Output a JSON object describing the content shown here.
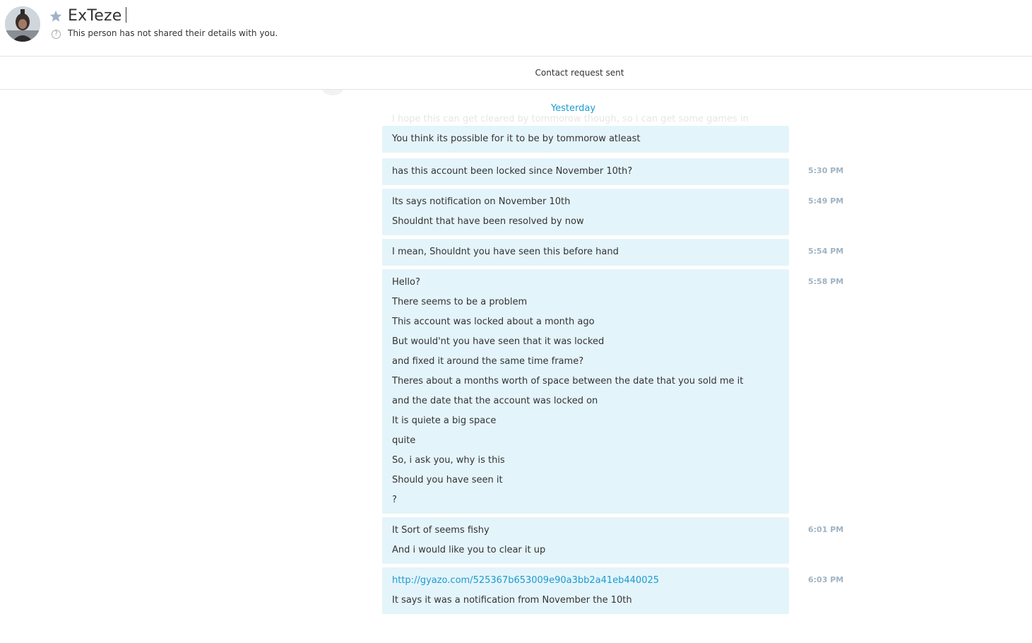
{
  "header": {
    "name": "ExTeze",
    "subtitle": "This person has not shared their details with you."
  },
  "request_bar": {
    "text": "Contact request sent"
  },
  "chat": {
    "day_label": "Yesterday",
    "faded_line": "I hope this can get cleared by tommorow though, so i can get some games in",
    "messages": [
      {
        "time": "",
        "lines": [
          "You think its possible for it to be by tommorow atleast"
        ]
      },
      {
        "time": "5:30 PM",
        "lines": [
          "has this account been locked since November 10th?"
        ]
      },
      {
        "time": "5:49 PM",
        "lines": [
          "Its says notification on November 10th",
          "Shouldnt that have been resolved by now"
        ]
      },
      {
        "time": "5:54 PM",
        "lines": [
          "I mean, Shouldnt you have seen this before hand"
        ]
      },
      {
        "time": "5:58 PM",
        "lines": [
          "Hello?",
          "There seems to be a problem",
          "This account was locked about a month ago",
          "But would'nt you have seen that it was locked",
          "and fixed it around the same time frame?",
          "Theres about a months worth of space between the date that you sold me it",
          "and the date that the account was locked on",
          "It is quiete a big space",
          "quite",
          "So, i ask you, why is this",
          "Should you have seen it",
          "?"
        ]
      },
      {
        "time": "6:01 PM",
        "lines": [
          "It Sort of seems fishy",
          "And i would like you to clear it up"
        ]
      },
      {
        "time": "6:03 PM",
        "link": "http://gyazo.com/525367b653009e90a3bb2a41eb440025",
        "lines": [
          "It says it was a notification from November the 10th"
        ]
      }
    ]
  },
  "colors": {
    "bubble": "#e4f4fb",
    "accent": "#1a9ccf",
    "time": "#9fb3c3"
  }
}
